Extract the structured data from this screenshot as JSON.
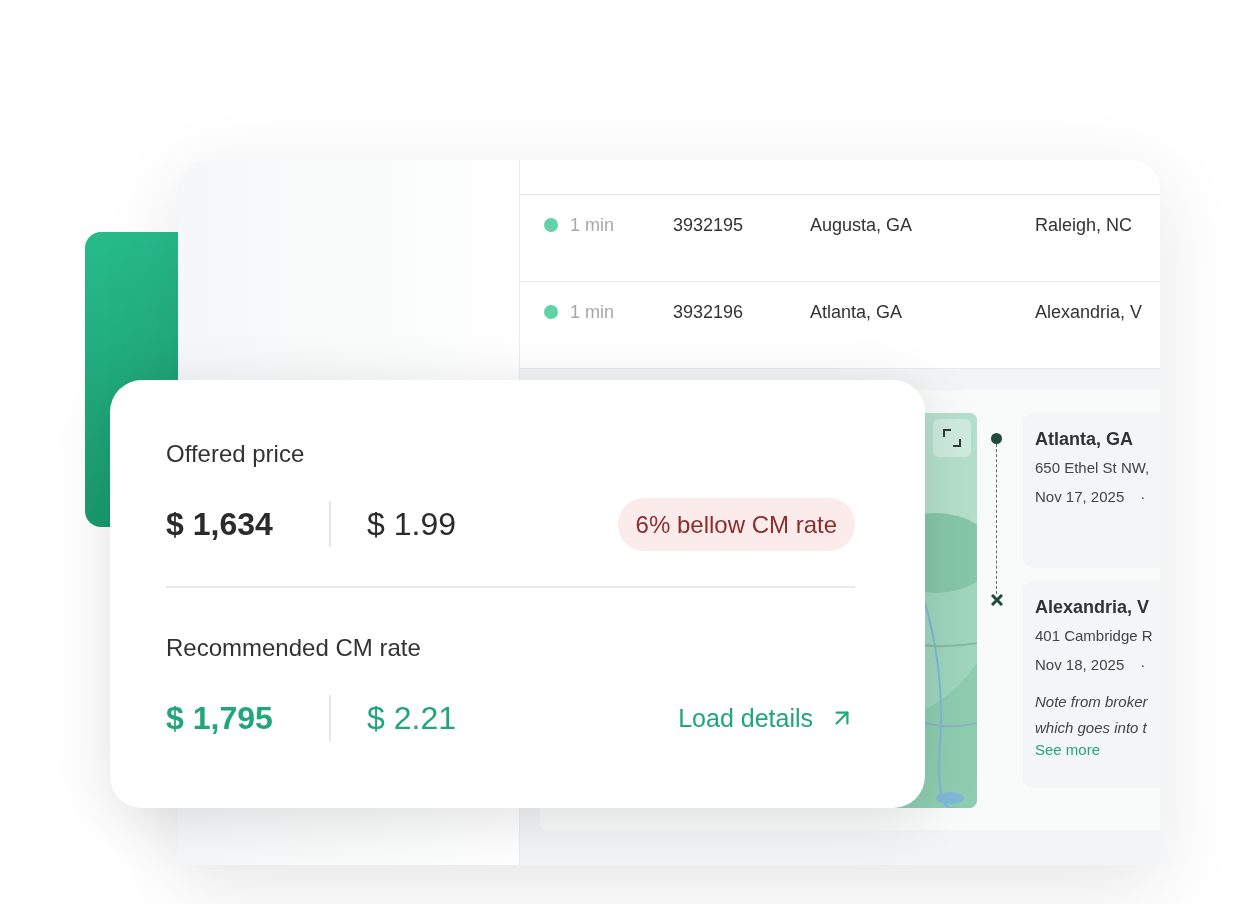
{
  "table": {
    "rows": [
      {
        "age": "1 min",
        "load_id": "3932195",
        "origin": "Augusta, GA",
        "destination": "Raleigh, NC"
      },
      {
        "age": "1 min",
        "load_id": "3932196",
        "origin": "Atlanta, GA",
        "destination": "Alexandria, V"
      }
    ]
  },
  "stops": [
    {
      "kind": "pickup",
      "city": "Atlanta, GA",
      "address": "650 Ethel St NW,",
      "date": "Nov 17, 2025",
      "separator": "·"
    },
    {
      "kind": "dropoff",
      "city": "Alexandria, V",
      "address": "401 Cambridge R",
      "date": "Nov 18, 2025",
      "separator": "·",
      "note": [
        "Note from broker",
        "which goes into t"
      ],
      "link": "See more"
    }
  ],
  "price_card": {
    "offered": {
      "label": "Offered price",
      "total": "$ 1,634",
      "per_mile": "$ 1.99",
      "badge": "6% bellow CM rate"
    },
    "recommended": {
      "label": "Recommended CM rate",
      "total": "$ 1,795",
      "per_mile": "$ 2.21",
      "link": "Load details"
    }
  }
}
